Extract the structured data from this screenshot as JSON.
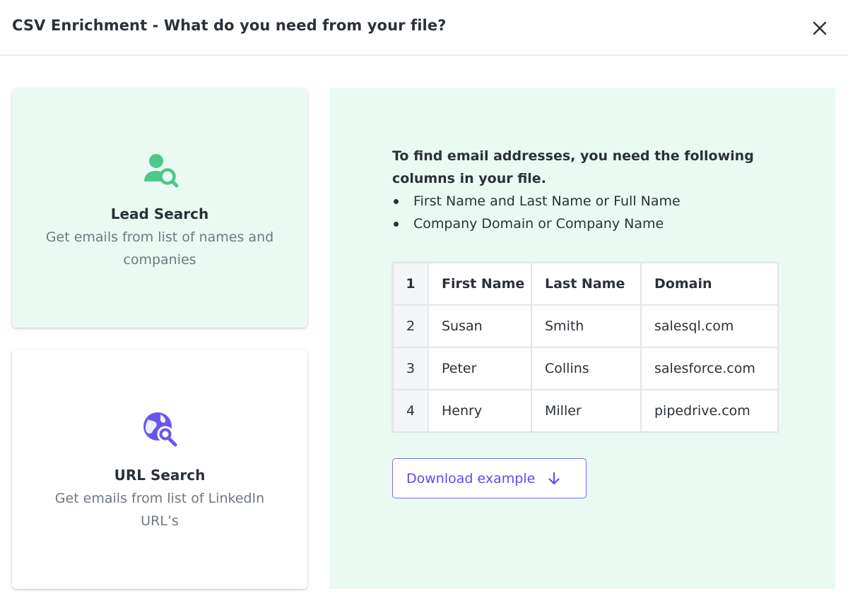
{
  "header": {
    "title": "CSV Enrichment - What do you need from your file?"
  },
  "options": [
    {
      "title": "Lead Search",
      "description": "Get emails from list of names and companies",
      "icon": "user-search-icon",
      "selected": true
    },
    {
      "title": "URL Search",
      "description": "Get emails from list of LinkedIn URL’s",
      "icon": "globe-search-icon",
      "selected": false
    }
  ],
  "panel": {
    "instructions": "To find email addresses, you need the following columns in your file.",
    "requirements": [
      "First Name and Last Name or Full Name",
      "Company Domain or Company Name"
    ],
    "table": {
      "rows": [
        [
          "1",
          "First Name",
          "Last Name",
          "Domain"
        ],
        [
          "2",
          "Susan",
          "Smith",
          "salesql.com"
        ],
        [
          "3",
          "Peter",
          "Collins",
          "salesforce.com"
        ],
        [
          "4",
          "Henry",
          "Miller",
          "pipedrive.com"
        ]
      ]
    },
    "download_label": "Download example"
  },
  "colors": {
    "green_accent": "#4cc98a",
    "purple_accent": "#6757f0",
    "selected_bg": "#eafaf2",
    "text": "#2b3138",
    "muted_text": "#6f7780"
  }
}
